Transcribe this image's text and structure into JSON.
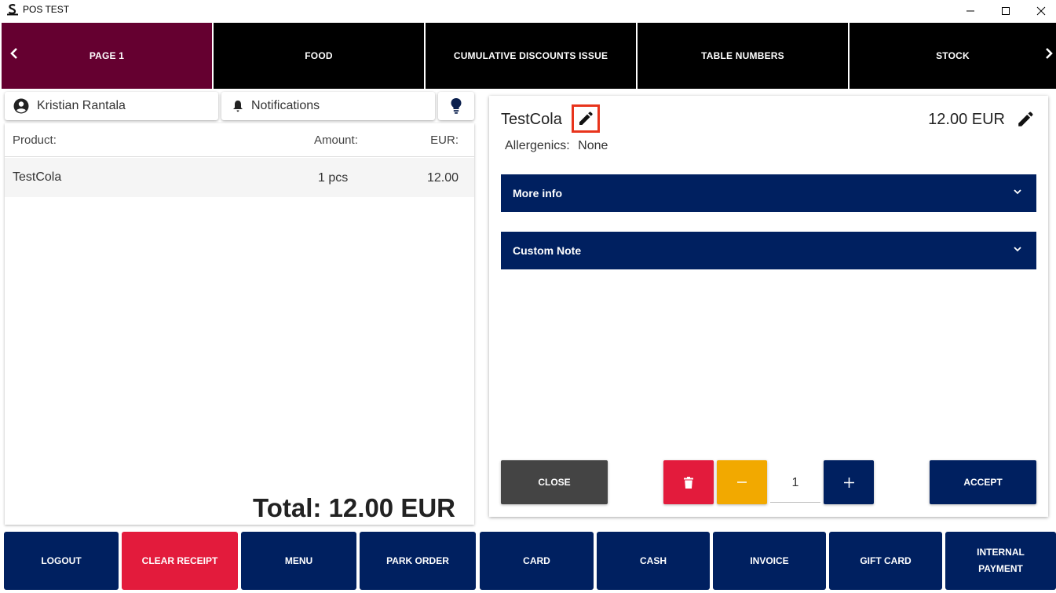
{
  "window": {
    "title": "POS TEST",
    "app_icon": "pos-logo-icon",
    "controls": [
      "minimize-icon",
      "maximize-icon",
      "close-icon"
    ]
  },
  "tabs": {
    "items": [
      {
        "label": "PAGE 1",
        "active": true
      },
      {
        "label": "FOOD",
        "active": false
      },
      {
        "label": "CUMULATIVE DISCOUNTS ISSUE",
        "active": false
      },
      {
        "label": "TABLE NUMBERS",
        "active": false
      },
      {
        "label": "STOCK",
        "active": false
      }
    ],
    "active_color": "#650030",
    "inactive_color": "#000000"
  },
  "header": {
    "user_name": "Kristian Rantala",
    "notifications_label": "Notifications",
    "hint_icon": "lightbulb-icon"
  },
  "receipt": {
    "columns": {
      "product": "Product:",
      "amount": "Amount:",
      "eur": "EUR:"
    },
    "rows": [
      {
        "product": "TestCola",
        "amount": "1 pcs",
        "eur": "12.00"
      }
    ],
    "total": "Total: 12.00 EUR"
  },
  "detail": {
    "name": "TestCola",
    "price": "12.00 EUR",
    "allergenics_label": "Allergenics:",
    "allergenics_value": "None",
    "sections": [
      {
        "label": "More info"
      },
      {
        "label": "Custom Note"
      }
    ],
    "close_label": "CLOSE",
    "quantity": "1",
    "accept_label": "ACCEPT"
  },
  "bottom": {
    "logout": "LOGOUT",
    "clear_receipt": "CLEAR RECEIPT",
    "menu": "MENU",
    "park_order": "PARK ORDER",
    "card": "CARD",
    "cash": "CASH",
    "invoice": "INVOICE",
    "gift_card": "GIFT CARD",
    "internal_payment_1": "INTERNAL",
    "internal_payment_2": "PAYMENT"
  },
  "colors": {
    "navy": "#002060",
    "red": "#e31b3c",
    "amber": "#f2a900",
    "close_gray": "#444444",
    "highlight": "#e8341c"
  }
}
